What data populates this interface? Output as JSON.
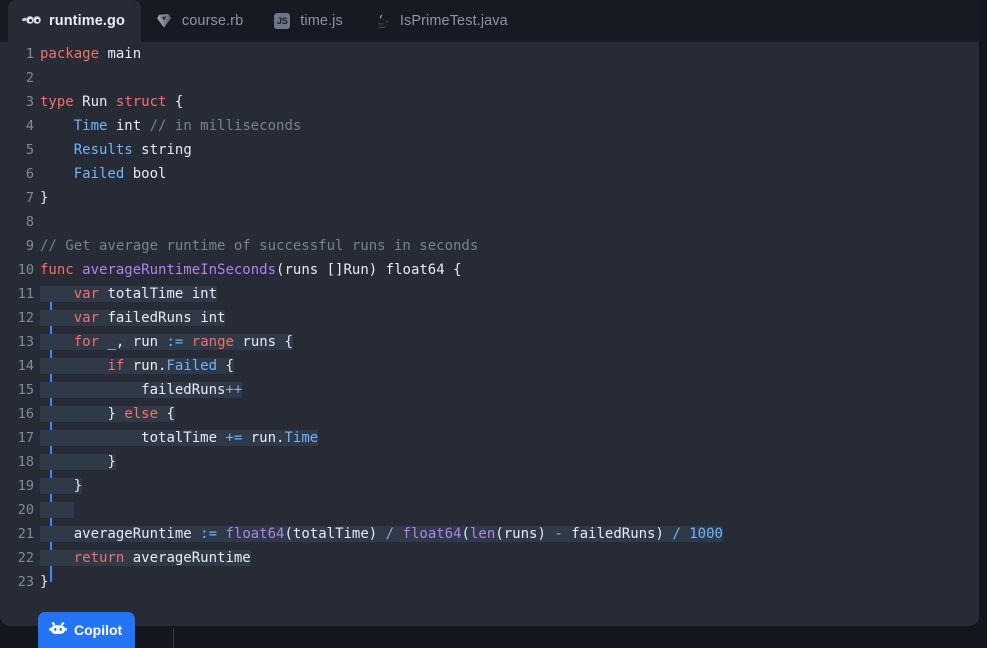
{
  "window": {
    "accent_color": "#2574f5",
    "editor_bg": "#262b36",
    "tabbar_bg": "#171a22",
    "selection_bg": "#303947",
    "block_indicator_color": "#3d8bfd"
  },
  "tabs": [
    {
      "label": "runtime.go",
      "icon": "go-gopher-icon",
      "active": true
    },
    {
      "label": "course.rb",
      "icon": "ruby-gem-icon",
      "active": false
    },
    {
      "label": "time.js",
      "icon": "javascript-icon",
      "active": false
    },
    {
      "label": "IsPrimeTest.java",
      "icon": "java-cup-icon",
      "active": false
    }
  ],
  "editor": {
    "language": "go",
    "line_numbers": [
      "1",
      "2",
      "3",
      "4",
      "5",
      "6",
      "7",
      "8",
      "9",
      "10",
      "11",
      "12",
      "13",
      "14",
      "15",
      "16",
      "17",
      "18",
      "19",
      "20",
      "21",
      "22",
      "23"
    ],
    "lines": [
      {
        "n": "1",
        "text": "package main"
      },
      {
        "n": "2",
        "text": ""
      },
      {
        "n": "3",
        "text": "type Run struct {"
      },
      {
        "n": "4",
        "text": "    Time int // in milliseconds"
      },
      {
        "n": "5",
        "text": "    Results string"
      },
      {
        "n": "6",
        "text": "    Failed bool"
      },
      {
        "n": "7",
        "text": "}"
      },
      {
        "n": "8",
        "text": ""
      },
      {
        "n": "9",
        "text": "// Get average runtime of successful runs in seconds"
      },
      {
        "n": "10",
        "text": "func averageRuntimeInSeconds(runs []Run) float64 {"
      },
      {
        "n": "11",
        "text": "    var totalTime int"
      },
      {
        "n": "12",
        "text": "    var failedRuns int"
      },
      {
        "n": "13",
        "text": "    for _, run := range runs {"
      },
      {
        "n": "14",
        "text": "        if run.Failed {"
      },
      {
        "n": "15",
        "text": "            failedRuns++"
      },
      {
        "n": "16",
        "text": "        } else {"
      },
      {
        "n": "17",
        "text": "            totalTime += run.Time"
      },
      {
        "n": "18",
        "text": "        }"
      },
      {
        "n": "19",
        "text": "    }"
      },
      {
        "n": "20",
        "text": ""
      },
      {
        "n": "21",
        "text": "    averageRuntime := float64(totalTime) / float64(len(runs) - failedRuns) / 1000"
      },
      {
        "n": "22",
        "text": "    return averageRuntime"
      },
      {
        "n": "23",
        "text": "}"
      }
    ],
    "selection": {
      "start_line": "11",
      "end_line": "22"
    }
  },
  "copilot": {
    "label": "Copilot",
    "icon": "copilot-icon"
  }
}
